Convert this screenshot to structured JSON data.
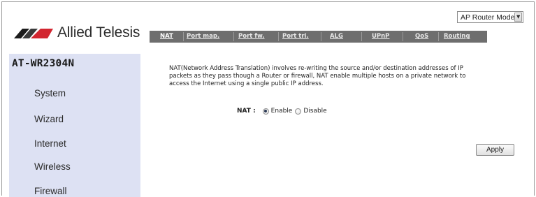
{
  "mode_select": {
    "value": "AP Router Mode",
    "icon": "chevron-down-icon"
  },
  "logo": {
    "text": "Allied Telesis",
    "colors": [
      "#1c1c1c",
      "#3a3a3a",
      "#d22630"
    ]
  },
  "tabs": [
    {
      "label": "NAT",
      "active": true
    },
    {
      "label": "Port map.",
      "active": false
    },
    {
      "label": "Port fw.",
      "active": false
    },
    {
      "label": "Port tri.",
      "active": false
    },
    {
      "label": "ALG",
      "active": false
    },
    {
      "label": "UPnP",
      "active": false
    },
    {
      "label": "QoS",
      "active": false
    },
    {
      "label": "Routing",
      "active": false
    }
  ],
  "sidebar": {
    "model": "AT-WR2304N",
    "items": [
      {
        "label": "System"
      },
      {
        "label": "Wizard"
      },
      {
        "label": "Internet"
      },
      {
        "label": "Wireless"
      },
      {
        "label": "Firewall"
      }
    ]
  },
  "main": {
    "description_lines": [
      "NAT(Network Address Translation) involves re-writing the source and/or destination addresses of IP",
      "packets as they pass though a Router or firewall, NAT enable multiple hosts on a private network to",
      "access the Internet using a single public IP address."
    ],
    "nat": {
      "label": "NAT :",
      "options": [
        {
          "label": "Enable",
          "checked": true
        },
        {
          "label": "Disable",
          "checked": false
        }
      ]
    },
    "apply_label": "Apply"
  },
  "colors": {
    "tab_bar": "#6e6e6e",
    "sidebar_bg": "#dde1f3",
    "brand_red": "#d22630"
  }
}
